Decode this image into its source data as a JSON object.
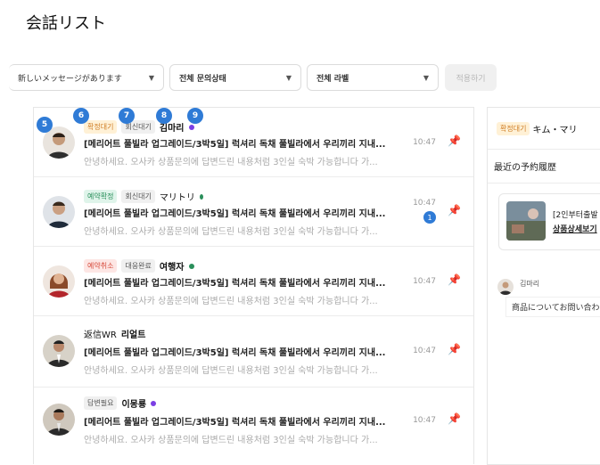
{
  "page": {
    "title": "会話リスト"
  },
  "filters": {
    "message_filter": "新しいメッセージがあります",
    "status_filter": "전체 문의상태",
    "label_filter": "전체 라벨",
    "apply_label": "적용하기"
  },
  "badges": [
    "5",
    "6",
    "7",
    "8",
    "9"
  ],
  "conversations": [
    {
      "tags": [
        "확정대기",
        "회신대기"
      ],
      "name": "김마리",
      "dot_color": "#7b3fe4",
      "subject": "[메리어트 풀빌라 업그레이드/3박5일] 럭셔리 독채 풀빌라에서 우리끼리 지내...",
      "preview": "안녕하세요. 오사카 상품문의에 답변드린 내용처럼 3인실 숙박 가능합니다 가...",
      "time": "10:47"
    },
    {
      "tags": [
        "예약확정",
        "회신대기"
      ],
      "name": "マリトリ",
      "dot_color": "#2a8f5b",
      "subject": "[메리어트 풀빌라 업그레이드/3박5일] 럭셔리 독채 풀빌라에서 우리끼리 지내...",
      "preview": "안녕하세요. 오사카 상품문의에 답변드린 내용처럼 3인실 숙박 가능합니다 가...",
      "time": "10:47",
      "unread": "1"
    },
    {
      "tags": [
        "예약취소",
        "대응완료"
      ],
      "name": "여행자",
      "dot_color": "#2a8f5b",
      "subject": "[메리어트 풀빌라 업그레이드/3박5일] 럭셔리 독채 풀빌라에서 우리끼리 지내...",
      "preview": "안녕하세요. 오사카 상품문의에 답변드린 내용처럼 3인실 숙박 가능합니다 가...",
      "time": "10:47"
    },
    {
      "tags": [
        "返信WR"
      ],
      "name": "리얼트",
      "subject": "[메리어트 풀빌라 업그레이드/3박5일] 럭셔리 독채 풀빌라에서 우리끼리 지내...",
      "preview": "안녕하세요. 오사카 상품문의에 답변드린 내용처럼 3인실 숙박 가능합니다 가...",
      "time": "10:47"
    },
    {
      "tags": [
        "답변필요"
      ],
      "name": "이몽룡",
      "dot_color": "#7b3fe4",
      "subject": "[메리어트 풀빌라 업그레이드/3박5일] 럭셔리 독채 풀빌라에서 우리끼리 지내...",
      "preview": "안녕하세요. 오사카 상품문의에 답변드린 내용처럼 3인실 숙박 가능합니다 가...",
      "time": "10:47"
    }
  ],
  "detail": {
    "status_tag": "확정대기",
    "customer_name": "キム・マリ",
    "section_title": "最近の予約履歴",
    "booking_title": "[2인부터출발",
    "booking_link": "상품상세보기",
    "message_author": "김마리",
    "message_text": "商品についてお問い合わ"
  },
  "colors": {
    "accent": "#2f7bd6",
    "tag_orange": "#d0802a",
    "tag_green": "#2a8f5b",
    "tag_red": "#d64a3b"
  }
}
